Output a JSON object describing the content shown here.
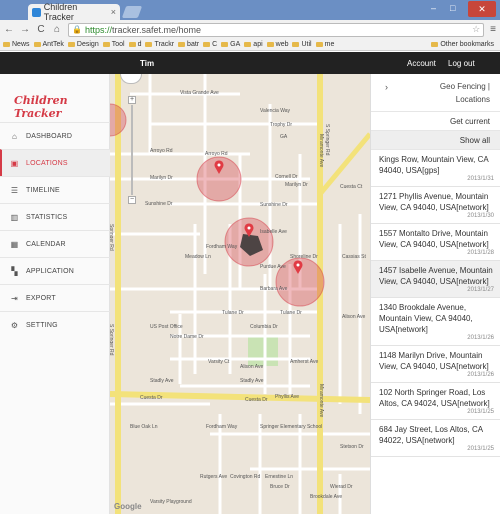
{
  "browser": {
    "tab_title": "Children Tracker",
    "tab_close": "×",
    "url_scheme": "https://",
    "url_rest": "tracker.safet.me/home",
    "win_min": "–",
    "win_max": "□",
    "win_close": "✕",
    "nav_back": "←",
    "nav_forward": "→",
    "nav_reload": "C",
    "nav_home": "⌂",
    "star": "☆",
    "menu": "≡",
    "bookmarks": [
      "News",
      "AntTek",
      "Design",
      "Tool",
      "d",
      "Trackr",
      "batr",
      "C",
      "GA",
      "api",
      "web",
      "Util",
      "me"
    ],
    "bookmarks_other": "Other bookmarks"
  },
  "appbar": {
    "user": "Tim",
    "account": "Account",
    "logout": "Log out"
  },
  "sidebar": {
    "brand": "Children Tracker",
    "items": [
      {
        "label": "DASHBOARD",
        "icon": "home-icon"
      },
      {
        "label": "LOCATIONS",
        "icon": "map-icon",
        "active": true
      },
      {
        "label": "TIMELINE",
        "icon": "list-icon"
      },
      {
        "label": "STATISTICS",
        "icon": "bar-chart-icon"
      },
      {
        "label": "CALENDAR",
        "icon": "calendar-icon"
      },
      {
        "label": "APPLICATION",
        "icon": "grid-icon"
      },
      {
        "label": "EXPORT",
        "icon": "export-icon"
      },
      {
        "label": "SETTING",
        "icon": "gear-icon"
      }
    ]
  },
  "map": {
    "streets": [
      "Vista Grande Ave",
      "Valencia Way",
      "Trophy Dr",
      "Arroyo Rd",
      "Arroyo Rd",
      "Marilyn Dr",
      "Marilyn Dr",
      "Sunshine Dr",
      "Sunshine Dr",
      "Barbara Ave",
      "Tulane Dr",
      "Tulane Dr",
      "Varsity Ct",
      "Stadly Ave",
      "Stadly Ave",
      "Cuesta Dr",
      "Cuesta Dr",
      "Fordham Way",
      "Fordham Way",
      "Meadow Ln",
      "Isabelle Ave",
      "Miramonte Ave",
      "Miramonte Ave",
      "Springer Rd",
      "S Springer Rd",
      "S Springer Rd",
      "Cassias St",
      "Alison Ave",
      "Alison Ave",
      "Varsity Playground",
      "Springer Elementary School",
      "US Post Office",
      "Notre Dame Dr",
      "Columbia Dr",
      "Purdue Ave",
      "Cornell Dr",
      "GA",
      "Phyllis Ave",
      "Covington Rd",
      "Ernestine Ln",
      "Rutgers Ave",
      "Brookdale Ave",
      "Wierad Dr",
      "Stetson Dr",
      "Blue Oak Ln",
      "Bruce Dr",
      "Cuesta Ct",
      "Shoreline Dr",
      "Amherst Ave",
      "Harvard Ave",
      "Homestead Way"
    ],
    "zoom_in": "+",
    "zoom_out": "−",
    "google": "Google"
  },
  "panel": {
    "title_line1": "Geo Fencing |",
    "title_line2": "Locations",
    "chevron": "›",
    "get_current": "Get current",
    "show_all": "Show all",
    "locations": [
      {
        "address": "Kings Row, Mountain View, CA 94040, USA[gps]",
        "date": "2013/1/31"
      },
      {
        "address": "1271 Phyllis Avenue, Mountain View, CA 94040, USA[network]",
        "date": "2013/1/30"
      },
      {
        "address": "1557 Montalto Drive, Mountain View, CA 94040, USA[network]",
        "date": "2013/1/28"
      },
      {
        "address": "1457 Isabelle Avenue, Mountain View, CA 94040, USA[network]",
        "date": "2013/1/27",
        "selected": true
      },
      {
        "address": "1340 Brookdale Avenue, Mountain View, CA 94040, USA[network]",
        "date": "2013/1/26"
      },
      {
        "address": "1148 Marilyn Drive, Mountain View, CA 94040, USA[network]",
        "date": "2013/1/26"
      },
      {
        "address": "102 North Springer Road, Los Altos, CA 94024, USA[network]",
        "date": "2013/1/25"
      },
      {
        "address": "684 Jay Street, Los Altos, CA 94022, USA[network]",
        "date": "2013/1/25"
      }
    ]
  },
  "colors": {
    "accent": "#d53a46",
    "appbar": "#222222",
    "highway": "#f3e27a",
    "park": "#c9e3b4"
  }
}
